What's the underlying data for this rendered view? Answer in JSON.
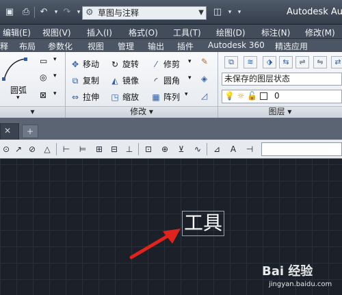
{
  "titlebar": {
    "workspace": "草图与注释",
    "app_title": "Autodesk Auto"
  },
  "menubar": {
    "items": [
      "编辑(E)",
      "视图(V)",
      "插入(I)",
      "格式(O)",
      "工具(T)",
      "绘图(D)",
      "标注(N)",
      "修改(M)"
    ]
  },
  "ribbon_tabs": [
    "释",
    "布局",
    "参数化",
    "视图",
    "管理",
    "输出",
    "插件",
    "Autodesk 360",
    "精选应用"
  ],
  "ribbon": {
    "draw": {
      "arc_label": "圆弧"
    },
    "modify": {
      "move": "移动",
      "rotate": "旋转",
      "trim": "修剪",
      "copy": "复制",
      "mirror": "镜像",
      "fillet": "圆角",
      "stretch": "拉伸",
      "scale": "缩放",
      "array": "阵列",
      "panel_title": "修改"
    },
    "layers": {
      "state": "未保存的图层状态",
      "current": "0",
      "panel_title": "图层"
    }
  },
  "canvas": {
    "text": "工具"
  },
  "watermark": {
    "brand": "Bai 经验",
    "url": "jingyan.baidu.com"
  },
  "colors": {
    "canvas_bg": "#1b2029",
    "arrow": "#e0231c",
    "accent_blue": "#2b5ea8"
  }
}
